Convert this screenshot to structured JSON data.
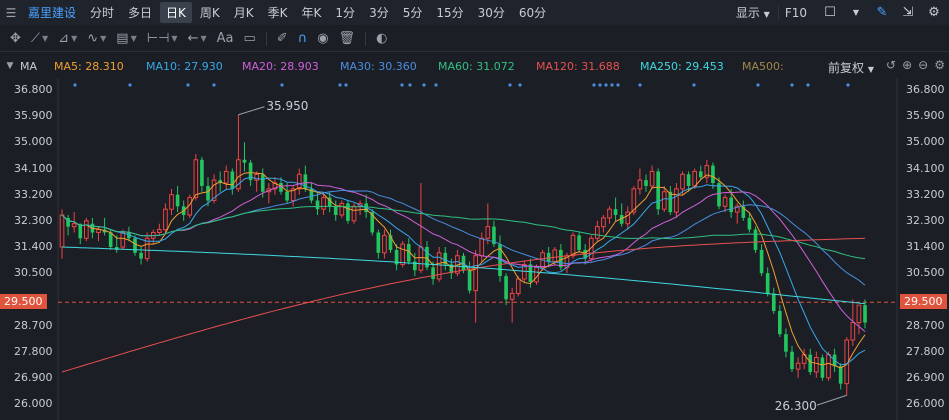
{
  "topbar": {
    "stock_name": "嘉里建设",
    "periods": [
      "分时",
      "多日",
      "日K",
      "周K",
      "月K",
      "季K",
      "年K",
      "1分",
      "3分",
      "5分",
      "15分",
      "30分",
      "60分"
    ],
    "active_period": "日K",
    "display_label": "显示",
    "f10_label": "F10"
  },
  "legend": {
    "indicator": "MA",
    "items": [
      {
        "text": "MA5: 28.310",
        "color": "#f0a030"
      },
      {
        "text": "MA10: 27.930",
        "color": "#38a8e8"
      },
      {
        "text": "MA20: 28.903",
        "color": "#d060d8"
      },
      {
        "text": "MA30: 30.360",
        "color": "#4a8ee0"
      },
      {
        "text": "MA60: 31.072",
        "color": "#30c080"
      },
      {
        "text": "MA120: 31.688",
        "color": "#e85050"
      },
      {
        "text": "MA250: 29.453",
        "color": "#40d8e0"
      },
      {
        "text": "MA500:",
        "color": "#a08848"
      }
    ],
    "adjust_label": "前复权"
  },
  "axis": {
    "ticks": [
      "36.800",
      "35.900",
      "35.000",
      "34.100",
      "33.200",
      "32.300",
      "31.400",
      "30.500",
      "29.500",
      "28.700",
      "27.800",
      "26.900",
      "26.000"
    ],
    "current_price": "29.500"
  },
  "annotations": {
    "high": "35.950",
    "low": "26.300"
  },
  "chart_data": {
    "type": "candlestick",
    "ylim": [
      26.0,
      36.8
    ],
    "annotations": {
      "high": 35.95,
      "low": 26.3,
      "current": 29.5
    },
    "candles": [
      [
        31.4,
        32.7,
        31.0,
        32.5
      ],
      [
        32.4,
        32.5,
        31.8,
        32.1
      ],
      [
        32.1,
        32.6,
        31.9,
        32.2
      ],
      [
        32.2,
        32.2,
        31.5,
        31.7
      ],
      [
        31.7,
        32.4,
        31.6,
        32.3
      ],
      [
        32.2,
        32.4,
        31.7,
        31.9
      ],
      [
        31.9,
        32.1,
        31.6,
        32.0
      ],
      [
        32.0,
        32.4,
        31.8,
        31.9
      ],
      [
        31.9,
        32.0,
        31.3,
        31.4
      ],
      [
        31.4,
        31.8,
        31.2,
        31.3
      ],
      [
        31.4,
        32.0,
        31.3,
        31.9
      ],
      [
        31.9,
        32.1,
        31.6,
        31.7
      ],
      [
        31.7,
        31.8,
        31.1,
        31.2
      ],
      [
        31.2,
        31.4,
        30.8,
        31.0
      ],
      [
        31.0,
        31.9,
        30.9,
        31.7
      ],
      [
        31.7,
        32.0,
        31.5,
        31.9
      ],
      [
        31.9,
        32.2,
        31.8,
        32.0
      ],
      [
        32.0,
        32.9,
        31.9,
        32.7
      ],
      [
        32.7,
        33.4,
        32.5,
        33.2
      ],
      [
        33.2,
        33.5,
        32.6,
        32.8
      ],
      [
        32.8,
        33.0,
        32.3,
        32.5
      ],
      [
        32.5,
        33.2,
        32.4,
        33.1
      ],
      [
        33.1,
        34.6,
        33.0,
        34.4
      ],
      [
        34.4,
        34.5,
        33.3,
        33.5
      ],
      [
        33.5,
        33.8,
        32.8,
        33.0
      ],
      [
        33.0,
        33.9,
        32.9,
        33.7
      ],
      [
        33.7,
        34.0,
        33.3,
        33.6
      ],
      [
        33.6,
        34.2,
        33.4,
        34.0
      ],
      [
        34.0,
        34.1,
        33.2,
        33.4
      ],
      [
        33.4,
        35.95,
        33.3,
        34.4
      ],
      [
        34.4,
        35.0,
        34.0,
        34.3
      ],
      [
        34.3,
        34.4,
        33.5,
        33.7
      ],
      [
        33.7,
        34.0,
        33.3,
        33.9
      ],
      [
        33.9,
        34.1,
        33.1,
        33.3
      ],
      [
        33.3,
        33.6,
        32.9,
        33.4
      ],
      [
        33.4,
        33.8,
        33.2,
        33.6
      ],
      [
        33.6,
        33.8,
        33.2,
        33.3
      ],
      [
        33.3,
        33.6,
        32.9,
        33.0
      ],
      [
        33.0,
        33.5,
        32.8,
        33.4
      ],
      [
        33.4,
        34.1,
        33.2,
        33.9
      ],
      [
        33.9,
        34.2,
        33.3,
        33.4
      ],
      [
        33.4,
        33.6,
        32.9,
        33.0
      ],
      [
        33.0,
        33.3,
        32.5,
        32.7
      ],
      [
        32.7,
        33.2,
        32.5,
        33.1
      ],
      [
        33.1,
        33.3,
        32.6,
        32.8
      ],
      [
        32.8,
        33.0,
        32.3,
        32.5
      ],
      [
        32.5,
        33.0,
        32.4,
        32.9
      ],
      [
        32.9,
        33.0,
        32.2,
        32.3
      ],
      [
        32.3,
        32.9,
        32.2,
        32.8
      ],
      [
        32.8,
        33.0,
        32.5,
        32.9
      ],
      [
        32.9,
        33.2,
        32.4,
        32.6
      ],
      [
        32.6,
        32.7,
        31.8,
        31.9
      ],
      [
        31.9,
        32.0,
        31.0,
        31.2
      ],
      [
        31.2,
        32.0,
        31.0,
        31.8
      ],
      [
        31.8,
        32.0,
        31.2,
        31.3
      ],
      [
        31.3,
        31.5,
        30.6,
        30.8
      ],
      [
        30.8,
        31.6,
        30.7,
        31.5
      ],
      [
        31.5,
        31.7,
        30.8,
        30.9
      ],
      [
        30.9,
        31.2,
        30.4,
        30.6
      ],
      [
        30.6,
        33.6,
        30.5,
        31.4
      ],
      [
        31.4,
        31.6,
        30.6,
        30.7
      ],
      [
        30.7,
        30.9,
        30.1,
        30.3
      ],
      [
        30.3,
        31.4,
        30.2,
        31.2
      ],
      [
        31.2,
        31.4,
        30.6,
        30.8
      ],
      [
        30.8,
        31.0,
        30.3,
        30.5
      ],
      [
        30.5,
        31.3,
        30.4,
        31.1
      ],
      [
        31.1,
        31.2,
        30.5,
        30.6
      ],
      [
        30.6,
        30.9,
        29.8,
        29.9
      ],
      [
        29.9,
        31.3,
        28.8,
        31.1
      ],
      [
        31.1,
        31.9,
        30.9,
        31.7
      ],
      [
        31.7,
        32.9,
        31.5,
        32.1
      ],
      [
        32.1,
        32.3,
        31.4,
        31.5
      ],
      [
        31.5,
        31.8,
        30.2,
        30.4
      ],
      [
        30.4,
        30.5,
        29.4,
        29.6
      ],
      [
        29.6,
        30.0,
        28.8,
        29.8
      ],
      [
        29.8,
        30.4,
        29.7,
        30.3
      ],
      [
        30.3,
        30.9,
        30.2,
        30.8
      ],
      [
        30.8,
        31.0,
        30.0,
        30.2
      ],
      [
        30.2,
        30.8,
        30.1,
        30.7
      ],
      [
        30.7,
        31.3,
        30.6,
        31.2
      ],
      [
        31.2,
        31.4,
        30.7,
        30.9
      ],
      [
        30.9,
        31.4,
        30.8,
        31.3
      ],
      [
        31.3,
        31.5,
        30.6,
        30.7
      ],
      [
        30.7,
        31.2,
        30.5,
        31.1
      ],
      [
        31.1,
        31.9,
        31.0,
        31.8
      ],
      [
        31.8,
        31.9,
        31.2,
        31.3
      ],
      [
        31.3,
        31.5,
        30.8,
        31.0
      ],
      [
        31.0,
        31.8,
        30.9,
        31.7
      ],
      [
        31.7,
        32.3,
        31.6,
        32.1
      ],
      [
        32.1,
        32.5,
        31.9,
        32.4
      ],
      [
        32.4,
        32.8,
        32.2,
        32.7
      ],
      [
        32.7,
        33.1,
        32.3,
        32.5
      ],
      [
        32.5,
        32.9,
        32.1,
        32.2
      ],
      [
        32.2,
        32.8,
        32.0,
        32.6
      ],
      [
        32.6,
        33.5,
        32.5,
        33.4
      ],
      [
        33.4,
        34.1,
        33.2,
        33.7
      ],
      [
        33.7,
        33.9,
        33.3,
        33.5
      ],
      [
        33.5,
        34.2,
        33.4,
        34.0
      ],
      [
        34.0,
        34.1,
        32.5,
        32.7
      ],
      [
        32.7,
        33.5,
        32.6,
        33.3
      ],
      [
        33.3,
        33.5,
        32.5,
        32.6
      ],
      [
        32.6,
        33.6,
        32.4,
        33.4
      ],
      [
        33.4,
        34.0,
        33.2,
        33.9
      ],
      [
        33.9,
        34.0,
        33.3,
        33.5
      ],
      [
        33.5,
        34.1,
        33.4,
        34.0
      ],
      [
        34.0,
        34.2,
        33.7,
        33.8
      ],
      [
        33.8,
        34.4,
        33.6,
        34.2
      ],
      [
        34.2,
        34.3,
        33.4,
        33.6
      ],
      [
        33.6,
        33.8,
        32.7,
        32.8
      ],
      [
        32.8,
        33.2,
        32.6,
        33.1
      ],
      [
        33.1,
        33.4,
        32.4,
        32.6
      ],
      [
        32.6,
        32.9,
        32.2,
        32.8
      ],
      [
        32.8,
        33.0,
        32.3,
        32.4
      ],
      [
        32.4,
        32.6,
        31.9,
        32.0
      ],
      [
        32.0,
        32.1,
        31.2,
        31.3
      ],
      [
        31.3,
        31.5,
        30.4,
        30.5
      ],
      [
        30.5,
        30.7,
        29.7,
        29.8
      ],
      [
        29.8,
        30.0,
        29.1,
        29.2
      ],
      [
        29.2,
        29.4,
        28.3,
        28.4
      ],
      [
        28.4,
        28.6,
        27.6,
        27.8
      ],
      [
        27.8,
        28.0,
        27.1,
        27.2
      ],
      [
        27.2,
        27.6,
        26.9,
        27.4
      ],
      [
        27.4,
        27.9,
        27.2,
        27.7
      ],
      [
        27.7,
        27.9,
        27.0,
        27.1
      ],
      [
        27.1,
        27.8,
        26.9,
        27.6
      ],
      [
        27.6,
        27.7,
        26.8,
        26.9
      ],
      [
        26.9,
        27.8,
        26.8,
        27.7
      ],
      [
        27.7,
        27.9,
        27.1,
        27.3
      ],
      [
        27.3,
        27.4,
        26.5,
        26.7
      ],
      [
        26.7,
        28.3,
        26.3,
        28.2
      ],
      [
        28.2,
        29.6,
        28.0,
        28.8
      ],
      [
        28.8,
        29.3,
        28.4,
        29.4
      ],
      [
        29.4,
        29.6,
        28.6,
        28.8
      ]
    ]
  }
}
